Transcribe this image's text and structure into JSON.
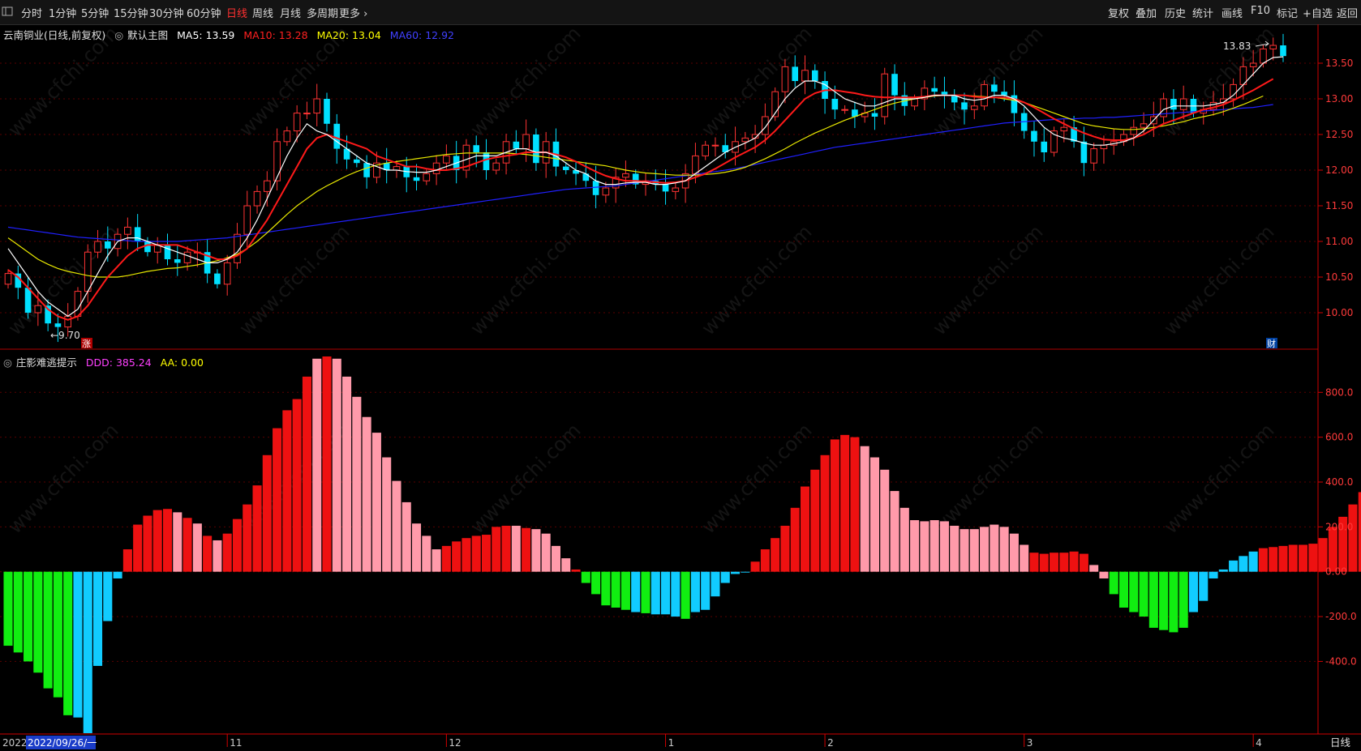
{
  "toolbar": {
    "periods": [
      "分时",
      "1分钟",
      "5分钟",
      "15分钟",
      "30分钟",
      "60分钟",
      "日线",
      "周线",
      "月线",
      "多周期",
      "更多 ›"
    ],
    "active_period": "日线",
    "right_buttons": [
      "复权",
      "叠加",
      "历史",
      "统计",
      "画线",
      "F10",
      "标记",
      "+自选",
      "返回"
    ]
  },
  "main_panel": {
    "title": "云南铜业(日线,前复权)",
    "template": "默认主图",
    "ma": [
      {
        "label": "MA5: 13.59",
        "color": "#ffffff"
      },
      {
        "label": "MA10: 13.28",
        "color": "#ff2020"
      },
      {
        "label": "MA20: 13.04",
        "color": "#ffff00"
      },
      {
        "label": "MA60: 12.92",
        "color": "#3030ff"
      }
    ],
    "high_label": "13.83",
    "low_label": "←9.70",
    "zhang_mark": "涨",
    "cai_mark": "财"
  },
  "indicator_panel": {
    "title": "庄影难逃提示",
    "ddd_label": "DDD: 385.24",
    "aa_label": "AA: 0.00",
    "ddd_color": "#ff40ff",
    "aa_color": "#ffff00"
  },
  "bottom_bar": {
    "period_label": "日线",
    "cursor_date": "2022/09/26/一",
    "year_stub": "2022"
  },
  "watermark": "www.cfchi.com",
  "colors": {
    "up_candle": "#ff3333",
    "down_candle": "#00e0ff",
    "bar_red": "#ee1111",
    "bar_pink": "#ff9aaa",
    "bar_green": "#11ee11",
    "bar_cyan": "#11ccff",
    "axis": "#ff2020",
    "grid": "#5a0000"
  },
  "chart_data": [
    {
      "type": "candlestick",
      "yticks": [
        "10.00",
        "10.50",
        "11.00",
        "11.50",
        "12.00",
        "12.50",
        "13.00",
        "13.50"
      ],
      "ylim": [
        9.5,
        14.0
      ],
      "xticks": [
        {
          "label": "11",
          "index": 22
        },
        {
          "label": "12",
          "index": 44
        },
        {
          "label": "1",
          "index": 66
        },
        {
          "label": "2",
          "index": 82
        },
        {
          "label": "3",
          "index": 102
        },
        {
          "label": "4",
          "index": 125
        }
      ],
      "close": [
        10.55,
        10.35,
        10.0,
        10.1,
        9.85,
        9.8,
        9.95,
        10.3,
        10.85,
        11.0,
        10.9,
        11.1,
        11.2,
        11.0,
        10.85,
        10.95,
        10.75,
        10.7,
        10.85,
        10.85,
        10.55,
        10.4,
        10.7,
        11.1,
        11.5,
        11.7,
        11.85,
        12.4,
        12.55,
        12.8,
        12.8,
        13.0,
        12.65,
        12.3,
        12.15,
        12.1,
        11.9,
        12.1,
        12.0,
        12.05,
        11.9,
        11.85,
        11.95,
        12.1,
        12.2,
        12.0,
        12.35,
        12.25,
        12.0,
        12.1,
        12.4,
        12.3,
        12.5,
        12.1,
        12.4,
        12.05,
        12.0,
        11.95,
        11.85,
        11.65,
        11.75,
        11.9,
        11.95,
        11.8,
        11.85,
        11.8,
        11.7,
        11.75,
        11.95,
        12.2,
        12.35,
        12.35,
        12.25,
        12.4,
        12.45,
        12.5,
        12.75,
        13.1,
        13.45,
        13.25,
        13.4,
        13.25,
        13.0,
        12.85,
        12.85,
        12.75,
        12.8,
        12.75,
        13.35,
        13.05,
        12.9,
        13.0,
        13.15,
        13.1,
        13.05,
        12.95,
        12.85,
        12.9,
        13.2,
        13.1,
        13.05,
        12.8,
        12.55,
        12.4,
        12.25,
        12.55,
        12.6,
        12.4,
        12.1,
        12.3,
        12.35,
        12.4,
        12.5,
        12.6,
        12.65,
        12.75,
        13.0,
        12.85,
        13.0,
        12.8,
        12.85,
        12.95,
        13.0,
        13.2,
        13.45,
        13.5,
        13.7,
        13.75,
        13.6
      ],
      "open": [
        10.4,
        10.55,
        10.35,
        10.0,
        10.1,
        9.85,
        9.8,
        9.95,
        10.3,
        10.85,
        11.0,
        10.9,
        11.1,
        11.2,
        11.0,
        10.85,
        10.95,
        10.75,
        10.7,
        10.85,
        10.85,
        10.55,
        10.4,
        10.7,
        11.1,
        11.5,
        11.7,
        11.85,
        12.4,
        12.55,
        12.8,
        12.8,
        13.0,
        12.65,
        12.3,
        12.15,
        12.1,
        11.9,
        12.1,
        12.0,
        12.05,
        11.9,
        11.85,
        11.95,
        12.1,
        12.2,
        12.0,
        12.35,
        12.25,
        12.0,
        12.1,
        12.4,
        12.3,
        12.5,
        12.1,
        12.4,
        12.05,
        12.0,
        11.95,
        11.85,
        11.65,
        11.75,
        11.9,
        11.95,
        11.8,
        11.85,
        11.8,
        11.7,
        11.75,
        11.95,
        12.2,
        12.35,
        12.35,
        12.25,
        12.4,
        12.45,
        12.5,
        12.75,
        13.1,
        13.45,
        13.25,
        13.4,
        13.25,
        13.0,
        12.85,
        12.85,
        12.75,
        12.8,
        12.75,
        13.35,
        13.05,
        12.9,
        13.0,
        13.15,
        13.1,
        13.05,
        12.95,
        12.85,
        12.9,
        13.2,
        13.1,
        13.05,
        12.8,
        12.55,
        12.4,
        12.25,
        12.55,
        12.6,
        12.4,
        12.1,
        12.3,
        12.35,
        12.4,
        12.5,
        12.6,
        12.65,
        12.75,
        13.0,
        12.85,
        13.0,
        12.8,
        12.85,
        12.95,
        13.0,
        13.2,
        13.45,
        13.5,
        13.7,
        13.75
      ],
      "ma5": [
        10.9,
        10.7,
        10.5,
        10.3,
        10.15,
        10.05,
        9.95,
        10.05,
        10.3,
        10.55,
        10.8,
        11.0,
        11.05,
        11.05,
        11.0,
        10.95,
        10.9,
        10.85,
        10.8,
        10.75,
        10.7,
        10.7,
        10.75,
        10.85,
        11.05,
        11.3,
        11.6,
        11.9,
        12.2,
        12.45,
        12.65,
        12.55,
        12.5,
        12.4,
        12.3,
        12.2,
        12.1,
        12.05,
        12.0,
        12.0,
        11.98,
        11.97,
        11.97,
        12.0,
        12.05,
        12.1,
        12.15,
        12.2,
        12.2,
        12.2,
        12.25,
        12.3,
        12.3,
        12.25,
        12.25,
        12.2,
        12.1,
        12.0,
        11.95,
        11.85,
        11.8,
        11.8,
        11.82,
        11.83,
        11.83,
        11.8,
        11.8,
        11.82,
        11.85,
        11.95,
        12.05,
        12.15,
        12.25,
        12.32,
        12.38,
        12.45,
        12.6,
        12.8,
        13.0,
        13.15,
        13.25,
        13.25,
        13.2,
        13.1,
        13.0,
        12.95,
        12.9,
        12.9,
        12.95,
        13.0,
        13.0,
        13.0,
        13.02,
        13.05,
        13.05,
        13.05,
        13.0,
        12.98,
        13.0,
        13.05,
        13.05,
        13.0,
        12.9,
        12.75,
        12.6,
        12.5,
        12.45,
        12.42,
        12.38,
        12.35,
        12.35,
        12.37,
        12.4,
        12.45,
        12.55,
        12.7,
        12.85,
        12.9,
        12.9,
        12.9,
        12.9,
        12.92,
        12.95,
        13.05,
        13.2,
        13.35,
        13.5,
        13.58,
        13.59
      ],
      "ma10": [
        10.6,
        10.5,
        10.35,
        10.2,
        10.05,
        9.95,
        9.9,
        9.95,
        10.1,
        10.3,
        10.5,
        10.65,
        10.8,
        10.9,
        10.95,
        10.95,
        10.95,
        10.95,
        10.9,
        10.85,
        10.8,
        10.75,
        10.75,
        10.8,
        10.9,
        11.1,
        11.3,
        11.55,
        11.8,
        12.05,
        12.3,
        12.45,
        12.5,
        12.45,
        12.4,
        12.35,
        12.3,
        12.2,
        12.15,
        12.1,
        12.05,
        12.05,
        12.02,
        12.0,
        12.0,
        12.02,
        12.05,
        12.1,
        12.15,
        12.18,
        12.2,
        12.22,
        12.25,
        12.25,
        12.25,
        12.22,
        12.18,
        12.12,
        12.05,
        11.98,
        11.92,
        11.88,
        11.85,
        11.85,
        11.84,
        11.83,
        11.82,
        11.83,
        11.85,
        11.9,
        11.95,
        12.02,
        12.1,
        12.18,
        12.25,
        12.32,
        12.42,
        12.55,
        12.7,
        12.85,
        13.0,
        13.08,
        13.12,
        13.12,
        13.1,
        13.08,
        13.05,
        13.03,
        13.02,
        13.02,
        13.02,
        13.02,
        13.03,
        13.05,
        13.05,
        13.05,
        13.05,
        13.03,
        13.02,
        13.02,
        13.02,
        13.0,
        12.95,
        12.88,
        12.8,
        12.72,
        12.65,
        12.58,
        12.52,
        12.47,
        12.43,
        12.42,
        12.42,
        12.45,
        12.5,
        12.58,
        12.65,
        12.7,
        12.75,
        12.8,
        12.85,
        12.88,
        12.92,
        12.98,
        13.05,
        13.12,
        13.2,
        13.28
      ],
      "ma20": [
        11.05,
        10.95,
        10.85,
        10.75,
        10.68,
        10.62,
        10.58,
        10.55,
        10.52,
        10.5,
        10.5,
        10.5,
        10.52,
        10.55,
        10.58,
        10.6,
        10.62,
        10.63,
        10.65,
        10.67,
        10.7,
        10.73,
        10.77,
        10.82,
        10.9,
        11.0,
        11.12,
        11.25,
        11.38,
        11.5,
        11.6,
        11.7,
        11.78,
        11.85,
        11.92,
        11.98,
        12.03,
        12.07,
        12.1,
        12.12,
        12.14,
        12.16,
        12.18,
        12.2,
        12.22,
        12.23,
        12.24,
        12.24,
        12.24,
        12.24,
        12.24,
        12.23,
        12.22,
        12.2,
        12.18,
        12.16,
        12.14,
        12.12,
        12.1,
        12.08,
        12.06,
        12.03,
        12.0,
        11.98,
        11.96,
        11.95,
        11.94,
        11.93,
        11.93,
        11.93,
        11.94,
        11.95,
        11.97,
        12.0,
        12.04,
        12.1,
        12.16,
        12.23,
        12.3,
        12.38,
        12.45,
        12.52,
        12.58,
        12.64,
        12.7,
        12.75,
        12.8,
        12.85,
        12.9,
        12.94,
        12.97,
        13.0,
        13.02,
        13.04,
        13.05,
        13.05,
        13.05,
        13.04,
        13.03,
        13.02,
        13.0,
        12.98,
        12.95,
        12.9,
        12.85,
        12.8,
        12.75,
        12.7,
        12.65,
        12.62,
        12.6,
        12.58,
        12.57,
        12.57,
        12.58,
        12.6,
        12.62,
        12.65,
        12.68,
        12.72,
        12.75,
        12.78,
        12.82,
        12.87,
        12.92,
        12.98,
        13.04
      ],
      "ma60": [
        11.2,
        11.18,
        11.16,
        11.14,
        11.12,
        11.1,
        11.08,
        11.06,
        11.05,
        11.04,
        11.03,
        11.02,
        11.01,
        11.0,
        11.0,
        11.0,
        11.0,
        11.0,
        11.01,
        11.02,
        11.03,
        11.04,
        11.05,
        11.07,
        11.09,
        11.11,
        11.13,
        11.15,
        11.17,
        11.19,
        11.21,
        11.23,
        11.25,
        11.27,
        11.29,
        11.31,
        11.33,
        11.35,
        11.37,
        11.39,
        11.41,
        11.43,
        11.45,
        11.47,
        11.49,
        11.51,
        11.53,
        11.55,
        11.57,
        11.59,
        11.61,
        11.63,
        11.65,
        11.67,
        11.69,
        11.71,
        11.73,
        11.74,
        11.75,
        11.76,
        11.77,
        11.78,
        11.8,
        11.82,
        11.84,
        11.86,
        11.88,
        11.9,
        11.92,
        11.94,
        11.96,
        11.98,
        12.0,
        12.02,
        12.05,
        12.08,
        12.11,
        12.14,
        12.17,
        12.2,
        12.23,
        12.26,
        12.29,
        12.32,
        12.34,
        12.36,
        12.38,
        12.4,
        12.42,
        12.44,
        12.46,
        12.48,
        12.5,
        12.52,
        12.54,
        12.56,
        12.58,
        12.6,
        12.62,
        12.64,
        12.66,
        12.67,
        12.68,
        12.69,
        12.7,
        12.71,
        12.72,
        12.72,
        12.73,
        12.73,
        12.74,
        12.74,
        12.75,
        12.76,
        12.77,
        12.78,
        12.79,
        12.8,
        12.81,
        12.82,
        12.83,
        12.84,
        12.85,
        12.86,
        12.87,
        12.88,
        12.9,
        12.92
      ]
    },
    {
      "type": "bar",
      "yticks": [
        "-400.0",
        "-200.0",
        "0.00",
        "200.0",
        "400.0",
        "600.0",
        "800.0"
      ],
      "ylim": [
        -720,
        960
      ],
      "ddd": [
        -330,
        -360,
        -400,
        -450,
        -520,
        -560,
        -640,
        -650,
        -720,
        -420,
        -220,
        -30,
        100,
        210,
        250,
        275,
        280,
        265,
        240,
        215,
        160,
        140,
        170,
        235,
        300,
        385,
        520,
        640,
        720,
        770,
        870,
        950,
        960,
        950,
        870,
        780,
        690,
        620,
        510,
        405,
        310,
        215,
        160,
        100,
        115,
        135,
        150,
        160,
        165,
        200,
        205,
        205,
        195,
        190,
        170,
        115,
        60,
        10,
        -50,
        -100,
        -150,
        -160,
        -170,
        -180,
        -185,
        -190,
        -190,
        -200,
        -210,
        -180,
        -170,
        -110,
        -50,
        -10,
        0,
        45,
        100,
        150,
        205,
        285,
        380,
        455,
        520,
        590,
        610,
        600,
        560,
        510,
        455,
        360,
        285,
        230,
        225,
        230,
        225,
        205,
        190,
        190,
        200,
        210,
        200,
        170,
        120,
        85,
        80,
        85,
        85,
        90,
        80,
        30,
        -30,
        -100,
        -160,
        -180,
        -200,
        -250,
        -260,
        -270,
        -250,
        -180,
        -130,
        -30,
        10,
        50,
        70,
        90,
        105,
        110,
        115,
        120,
        120,
        125,
        150,
        200,
        245,
        300,
        355,
        385
      ],
      "colors": [
        "g",
        "g",
        "g",
        "g",
        "g",
        "g",
        "g",
        "c",
        "c",
        "c",
        "c",
        "c",
        "r",
        "r",
        "r",
        "r",
        "r",
        "p",
        "r",
        "p",
        "r",
        "p",
        "r",
        "r",
        "r",
        "r",
        "r",
        "r",
        "r",
        "r",
        "r",
        "p",
        "r",
        "p",
        "p",
        "p",
        "p",
        "p",
        "p",
        "p",
        "p",
        "p",
        "p",
        "p",
        "r",
        "r",
        "r",
        "r",
        "r",
        "r",
        "r",
        "p",
        "r",
        "p",
        "p",
        "p",
        "p",
        "r",
        "g",
        "g",
        "g",
        "g",
        "g",
        "c",
        "g",
        "c",
        "c",
        "c",
        "g",
        "c",
        "c",
        "c",
        "c",
        "c",
        "c",
        "r",
        "r",
        "r",
        "r",
        "r",
        "r",
        "r",
        "r",
        "r",
        "r",
        "r",
        "p",
        "p",
        "p",
        "p",
        "p",
        "p",
        "p",
        "p",
        "p",
        "p",
        "p",
        "p",
        "p",
        "p",
        "p",
        "p",
        "p",
        "r",
        "r",
        "r",
        "r",
        "r",
        "r",
        "p",
        "p",
        "g",
        "g",
        "g",
        "g",
        "g",
        "g",
        "g",
        "g",
        "c",
        "c",
        "c",
        "c",
        "c",
        "c",
        "c",
        "r",
        "r",
        "r",
        "r",
        "r",
        "r",
        "r",
        "r",
        "r",
        "r",
        "r",
        "r",
        "r",
        "r",
        "r",
        "r",
        "r",
        "r"
      ]
    }
  ]
}
